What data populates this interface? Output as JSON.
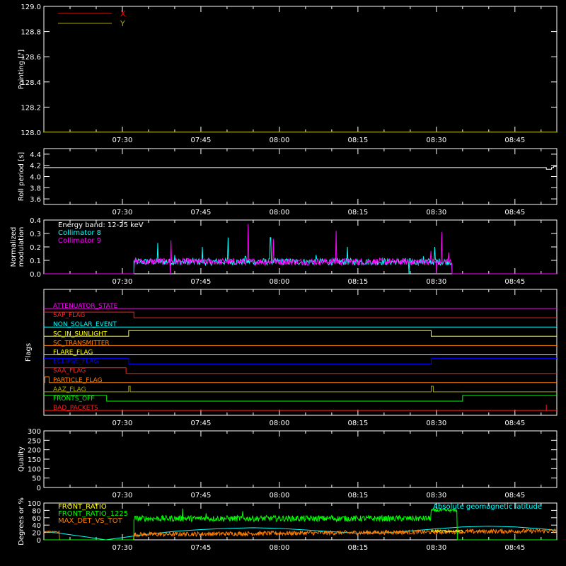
{
  "chart_data": [
    {
      "type": "line",
      "panel": "pointing",
      "ylabel": "Pointing [°]",
      "ylim": [
        128.0,
        129.0
      ],
      "yticks": [
        128.0,
        128.2,
        128.4,
        128.6,
        128.8,
        129.0
      ],
      "ytick_labels": [
        "128.0",
        "128.2",
        "128.4",
        "128.6",
        "128.8",
        "129.0"
      ],
      "xlim": [
        435,
        533
      ],
      "xticks": [
        450,
        465,
        480,
        495,
        510,
        525
      ],
      "xtick_labels": [
        "07:30",
        "07:45",
        "08:00",
        "08:15",
        "08:30",
        "08:45"
      ],
      "legend": "top-left",
      "series": [
        {
          "name": "X",
          "color": "#ff0000",
          "x": [
            435,
            533
          ],
          "y": [
            128.0,
            128.0
          ]
        },
        {
          "name": "Y",
          "color": "#a8a800",
          "x": [
            435,
            533
          ],
          "y": [
            128.0,
            128.0
          ]
        }
      ]
    },
    {
      "type": "line",
      "panel": "roll",
      "ylabel": "Roll period [s]",
      "ylim": [
        3.5,
        4.5
      ],
      "yticks": [
        3.6,
        3.8,
        4.0,
        4.2,
        4.4
      ],
      "ytick_labels": [
        "3.6",
        "3.8",
        "4.0",
        "4.2",
        "4.4"
      ],
      "xlim": [
        435,
        533
      ],
      "xticks": [
        450,
        465,
        480,
        495,
        510,
        525
      ],
      "xtick_labels": [
        "07:30",
        "07:45",
        "08:00",
        "08:15",
        "08:30",
        "08:45"
      ],
      "series": [
        {
          "name": "",
          "color": "#ffffff",
          "x": [
            435,
            531.0,
            531.0,
            532.0,
            532.0,
            532.4,
            532.4,
            533
          ],
          "y": [
            4.16,
            4.16,
            4.13,
            4.13,
            4.16,
            4.16,
            4.18,
            4.18
          ]
        }
      ]
    },
    {
      "type": "line",
      "panel": "modulation",
      "ylabel": "Normalized modulation",
      "ylim": [
        0.0,
        0.4
      ],
      "yticks": [
        0.0,
        0.1,
        0.2,
        0.3,
        0.4
      ],
      "ytick_labels": [
        "0.0",
        "0.1",
        "0.2",
        "0.3",
        "0.4"
      ],
      "xlim": [
        435,
        533
      ],
      "xticks": [
        450,
        465,
        480,
        495,
        510,
        525
      ],
      "xtick_labels": [
        "07:30",
        "07:45",
        "08:00",
        "08:15",
        "08:30",
        "08:45"
      ],
      "annotation": "Energy band: 12-25 keV",
      "noise_range": [
        452.2,
        513.0
      ],
      "series": [
        {
          "name": "Collimator 8",
          "color": "#00ffff",
          "baseline": 0.08,
          "spikes": [
            [
              456.8,
              0.23
            ],
            [
              460.0,
              0.14
            ],
            [
              465.3,
              0.2
            ],
            [
              470.2,
              0.27
            ],
            [
              473.5,
              0.13
            ],
            [
              478.3,
              0.27
            ],
            [
              487.0,
              0.14
            ],
            [
              493.0,
              0.2
            ],
            [
              499.7,
              0.12
            ],
            [
              504.8,
              0.13
            ],
            [
              507.5,
              0.13
            ],
            [
              509.7,
              0.2
            ],
            [
              513.0,
              0.15
            ]
          ],
          "dips": [
            [
              504.8,
              0.0
            ]
          ]
        },
        {
          "name": "Collimator 9",
          "color": "#ff00ff",
          "baseline": 0.08,
          "spikes": [
            [
              459.3,
              0.25
            ],
            [
              474.0,
              0.37
            ],
            [
              478.8,
              0.26
            ],
            [
              490.8,
              0.32
            ],
            [
              509.0,
              0.17
            ],
            [
              511.0,
              0.31
            ],
            [
              512.3,
              0.16
            ]
          ],
          "dips": [
            [
              452.2,
              0.0
            ],
            [
              459.2,
              0.0
            ],
            [
              510.0,
              0.0
            ],
            [
              513.0,
              0.0
            ]
          ]
        }
      ]
    },
    {
      "type": "line",
      "panel": "flags",
      "ylabel": "Flags",
      "xlim": [
        435,
        533
      ],
      "xticks": [
        450,
        465,
        480,
        495,
        510,
        525
      ],
      "xtick_labels": [
        "07:30",
        "07:45",
        "08:00",
        "08:15",
        "08:30",
        "08:45"
      ],
      "series": [
        {
          "name": "ATTENUATOR_STATE",
          "color": "#ff00ff",
          "steps": [
            [
              435,
              0
            ],
            [
              533,
              0
            ]
          ]
        },
        {
          "name": "SAP_FLAG",
          "color": "#ff2020",
          "steps": [
            [
              435,
              1
            ],
            [
              452.2,
              1
            ],
            [
              452.2,
              0
            ],
            [
              533,
              0
            ]
          ]
        },
        {
          "name": "NON_SOLAR_EVENT",
          "color": "#00ffff",
          "steps": [
            [
              435,
              0
            ],
            [
              533,
              0
            ]
          ]
        },
        {
          "name": "SC_IN_SUNLIGHT",
          "color": "#ffff00",
          "steps": [
            [
              435,
              0
            ],
            [
              451.2,
              0
            ],
            [
              451.2,
              1
            ],
            [
              509.0,
              1
            ],
            [
              509.0,
              0
            ],
            [
              533,
              0
            ]
          ]
        },
        {
          "name": "SC_TRANSMITTER",
          "color": "#ff7f00",
          "steps": [
            [
              435,
              0
            ],
            [
              533,
              0
            ]
          ]
        },
        {
          "name": "FLARE_FLAG",
          "color": "#ffff00",
          "steps": [
            [
              435,
              0
            ],
            [
              533,
              0
            ]
          ]
        },
        {
          "name": "ECLIPSE_FLAG",
          "color": "#0000ff",
          "steps": [
            [
              435,
              1
            ],
            [
              451.2,
              1
            ],
            [
              451.2,
              0
            ],
            [
              509.0,
              0
            ],
            [
              509.0,
              1
            ],
            [
              533,
              1
            ]
          ]
        },
        {
          "name": "SAA_FLAG",
          "color": "#ff2020",
          "steps": [
            [
              435,
              1
            ],
            [
              450.7,
              1
            ],
            [
              450.7,
              0
            ],
            [
              533,
              0
            ]
          ]
        },
        {
          "name": "PARTICLE_FLAG",
          "color": "#ff7f00",
          "steps": [
            [
              435,
              0
            ],
            [
              435.2,
              0
            ],
            [
              435.2,
              1
            ],
            [
              436.0,
              1
            ],
            [
              436.0,
              0
            ],
            [
              533,
              0
            ]
          ]
        },
        {
          "name": "AAZ_FLAG",
          "color": "#a8a800",
          "steps": [
            [
              435,
              0
            ],
            [
              451.2,
              0
            ],
            [
              451.2,
              1
            ],
            [
              451.5,
              1
            ],
            [
              451.5,
              0
            ],
            [
              509.0,
              0
            ],
            [
              509.0,
              1
            ],
            [
              509.4,
              1
            ],
            [
              509.4,
              0
            ],
            [
              533,
              0
            ]
          ]
        },
        {
          "name": "FRONTS_OFF",
          "color": "#00ff00",
          "steps": [
            [
              435,
              1
            ],
            [
              447.0,
              1
            ],
            [
              447.0,
              0
            ],
            [
              515.0,
              0
            ],
            [
              515.0,
              1
            ],
            [
              533,
              1
            ]
          ]
        },
        {
          "name": "BAD_PACKETS",
          "color": "#ff2020",
          "steps": [
            [
              435,
              0
            ],
            [
              531.0,
              0
            ],
            [
              531.0,
              1
            ],
            [
              531.0,
              0
            ],
            [
              533,
              0
            ]
          ]
        }
      ]
    },
    {
      "type": "line",
      "panel": "quality",
      "ylabel": "Quality",
      "ylim": [
        0,
        300
      ],
      "yticks": [
        0,
        50,
        100,
        150,
        200,
        250,
        300
      ],
      "ytick_labels": [
        "0",
        "50",
        "100",
        "150",
        "200",
        "250",
        "300"
      ],
      "xlim": [
        435,
        533
      ],
      "xticks": [
        450,
        465,
        480,
        495,
        510,
        525
      ],
      "xtick_labels": [
        "07:30",
        "07:45",
        "08:00",
        "08:15",
        "08:30",
        "08:45"
      ],
      "series": []
    },
    {
      "type": "line",
      "panel": "ratios",
      "ylabel": "Degrees or %",
      "ylim": [
        0,
        100
      ],
      "yticks": [
        0,
        20,
        40,
        60,
        80,
        100
      ],
      "ytick_labels": [
        "0",
        "20",
        "40",
        "60",
        "80",
        "100"
      ],
      "xlim": [
        435,
        533
      ],
      "xticks": [
        450,
        465,
        480,
        495,
        510,
        525
      ],
      "xtick_labels": [
        "07:30",
        "07:45",
        "08:00",
        "08:15",
        "08:30",
        "08:45"
      ],
      "legend": "top-left",
      "series": [
        {
          "name": "FRONT_RATIO",
          "color": "#ffff00",
          "x": [
            509.0,
            515.0
          ],
          "y": [
            25,
            25
          ]
        },
        {
          "name": "FRONT_RATIO_1225",
          "color": "#00ff00",
          "x": [
            452.2,
            509.0,
            509.0,
            514.0,
            514.0,
            515.0
          ],
          "y": [
            60,
            57,
            83,
            80,
            0,
            0
          ],
          "spikes": [
            [
              461.5,
              85
            ],
            [
              466.0,
              72
            ],
            [
              473.0,
              78
            ],
            [
              490.0,
              66
            ]
          ]
        },
        {
          "name": "MAX_DET_VS_TOT",
          "color": "#ff7f00",
          "x": [
            435,
            438.0,
            438.0,
            452.2,
            452.2,
            533
          ],
          "y": [
            20,
            20,
            0,
            0,
            18,
            22
          ]
        },
        {
          "name": "Absolute geomagnetic latitude",
          "color": "#00ffff",
          "x": [
            435,
            438,
            441,
            444,
            446.8,
            450,
            453,
            456,
            460,
            465,
            470,
            475,
            480,
            485,
            490,
            495,
            500,
            505,
            510,
            515,
            520,
            525,
            530,
            533
          ],
          "y": [
            22,
            18,
            12,
            6,
            0,
            6,
            12,
            17,
            23,
            28,
            31,
            33,
            31,
            27,
            22,
            18,
            19,
            24,
            30,
            35,
            37,
            35,
            30,
            26
          ]
        }
      ]
    }
  ]
}
